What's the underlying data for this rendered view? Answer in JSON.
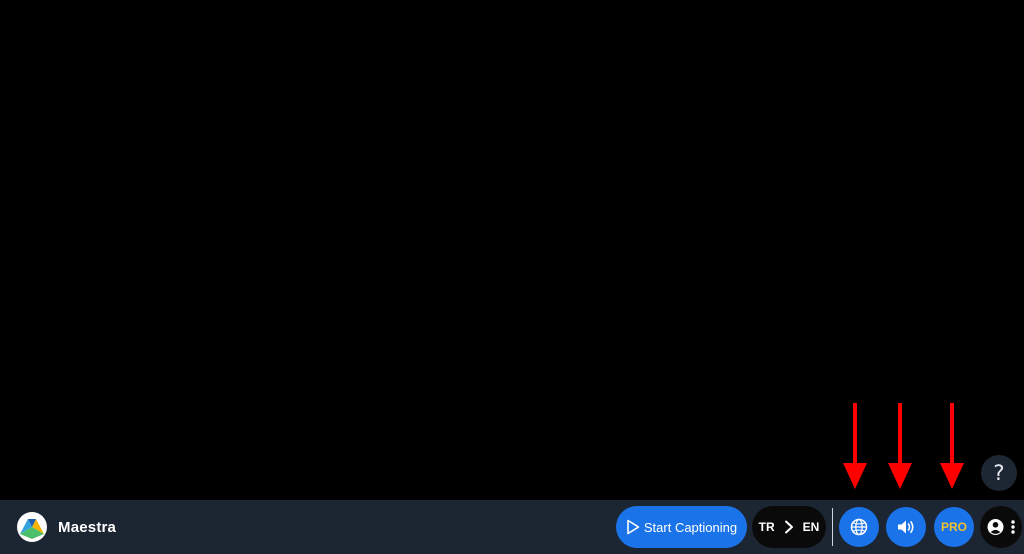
{
  "app": {
    "brand_name": "Maestra"
  },
  "toolbar": {
    "start_label": "Start Captioning",
    "source_lang": "TR",
    "target_lang": "EN",
    "pro_label": "PRO",
    "help_label": "?"
  },
  "icons": {
    "logo": "maestra-logo-icon",
    "play": "play-icon",
    "chevron": "chevron-right-icon",
    "globe": "globe-icon",
    "speaker": "speaker-icon",
    "account": "account-icon",
    "more": "more-vertical-icon",
    "arrow": "red-arrow-down-icon"
  },
  "colors": {
    "accent": "#1a73e8",
    "bar_background": "#1c2633",
    "pro_text": "#f2c12e",
    "annotation_arrow": "#ff0000"
  }
}
